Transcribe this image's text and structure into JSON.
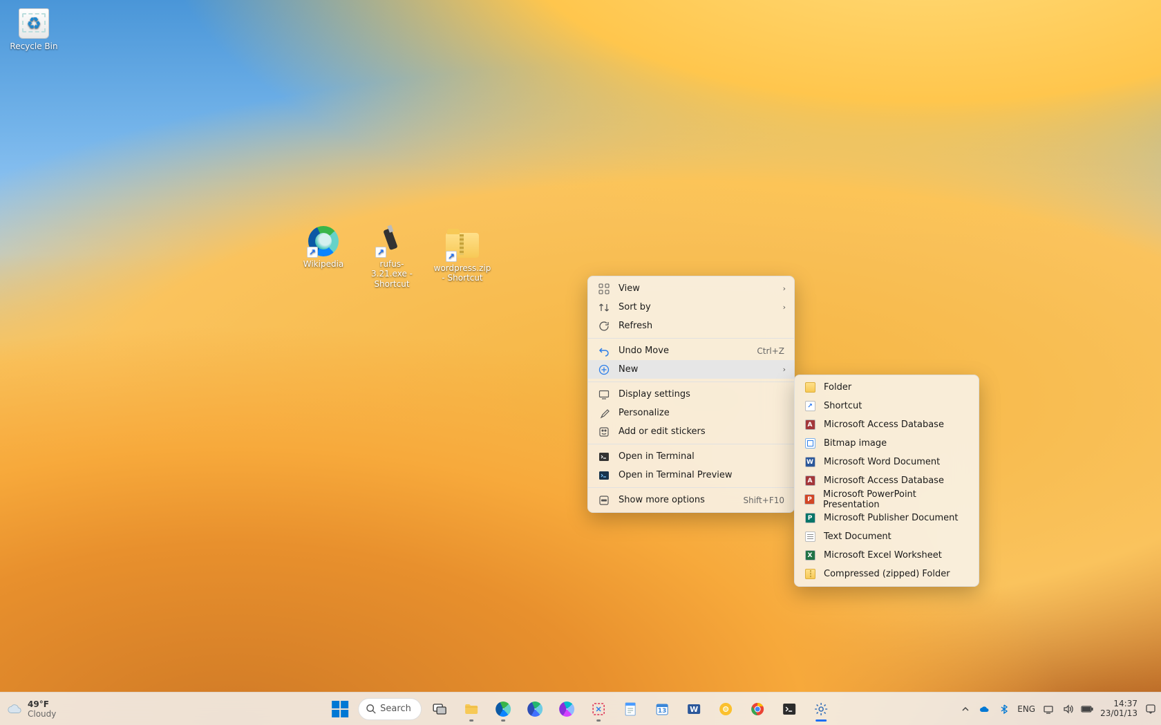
{
  "desktop": {
    "icons": {
      "recycle_bin": "Recycle Bin",
      "wikipedia": "Wikipedia",
      "rufus": "rufus-3.21.exe - Shortcut",
      "wordpress": "wordpress.zip - Shortcut"
    }
  },
  "context_menu": {
    "view": "View",
    "sort_by": "Sort by",
    "refresh": "Refresh",
    "undo_move": "Undo Move",
    "undo_shortcut": "Ctrl+Z",
    "new": "New",
    "display_settings": "Display settings",
    "personalize": "Personalize",
    "stickers": "Add or edit stickers",
    "open_terminal": "Open in Terminal",
    "open_terminal_preview": "Open in Terminal Preview",
    "show_more": "Show more options",
    "show_more_shortcut": "Shift+F10"
  },
  "new_submenu": {
    "folder": "Folder",
    "shortcut": "Shortcut",
    "access": "Microsoft Access Database",
    "bitmap": "Bitmap image",
    "word": "Microsoft Word Document",
    "access2": "Microsoft Access Database",
    "ppt": "Microsoft PowerPoint Presentation",
    "publisher": "Microsoft Publisher Document",
    "text": "Text Document",
    "excel": "Microsoft Excel Worksheet",
    "zip": "Compressed (zipped) Folder"
  },
  "taskbar": {
    "weather": {
      "temp": "49°F",
      "cond": "Cloudy"
    },
    "search_label": "Search",
    "language": "ENG",
    "clock": {
      "time": "14:37",
      "date": "23/01/13"
    }
  }
}
